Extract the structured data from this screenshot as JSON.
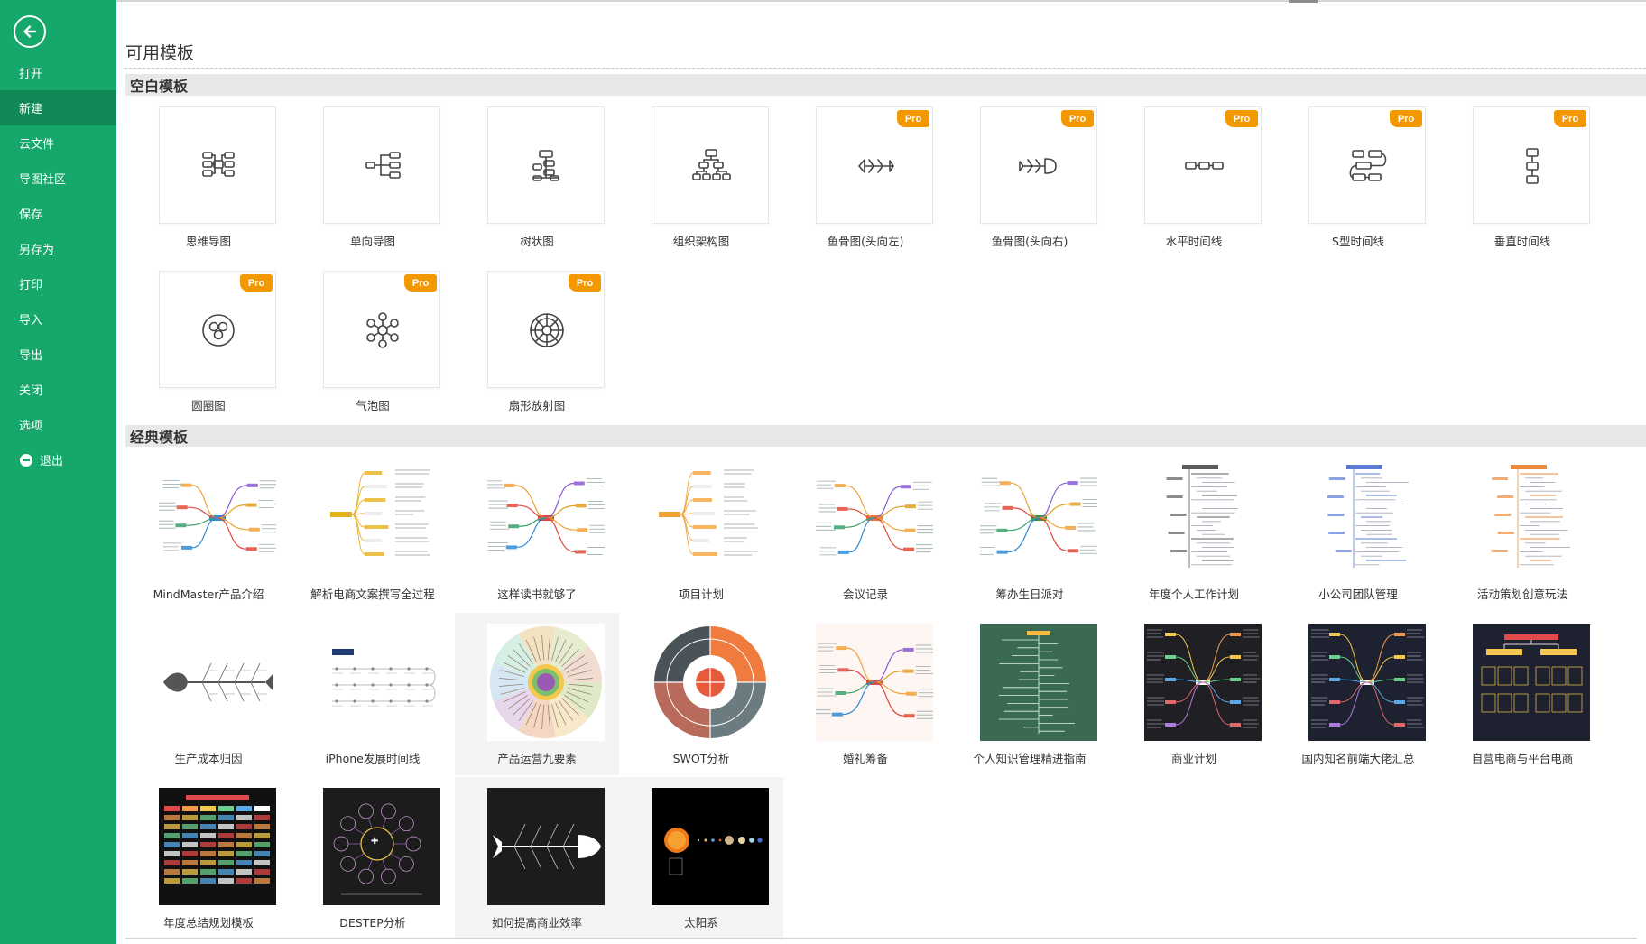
{
  "sidebar": {
    "back_icon": "arrow-left-icon",
    "items": [
      {
        "label": "打开"
      },
      {
        "label": "新建",
        "active": true
      },
      {
        "label": "云文件"
      },
      {
        "label": "导图社区"
      },
      {
        "label": "保存"
      },
      {
        "label": "另存为"
      },
      {
        "label": "打印"
      },
      {
        "label": "导入"
      },
      {
        "label": "导出"
      },
      {
        "label": "关闭"
      },
      {
        "label": "选项"
      },
      {
        "label": "退出",
        "icon": "minus-circle-icon"
      }
    ]
  },
  "page": {
    "title": "可用模板"
  },
  "blank_section": {
    "title": "空白模板",
    "pro_label": "Pro",
    "templates": [
      {
        "label": "思维导图",
        "icon": "mind-map-icon",
        "pro": false
      },
      {
        "label": "单向导图",
        "icon": "right-map-icon",
        "pro": false
      },
      {
        "label": "树状图",
        "icon": "tree-map-icon",
        "pro": false
      },
      {
        "label": "组织架构图",
        "icon": "org-chart-icon",
        "pro": false
      },
      {
        "label": "鱼骨图(头向左)",
        "icon": "fishbone-left-icon",
        "pro": true
      },
      {
        "label": "鱼骨图(头向右)",
        "icon": "fishbone-right-icon",
        "pro": true
      },
      {
        "label": "水平时间线",
        "icon": "horizontal-timeline-icon",
        "pro": true
      },
      {
        "label": "S型时间线",
        "icon": "s-timeline-icon",
        "pro": true
      },
      {
        "label": "垂直时间线",
        "icon": "vertical-timeline-icon",
        "pro": true
      },
      {
        "label": "圆圈图",
        "icon": "circle-map-icon",
        "pro": true
      },
      {
        "label": "气泡图",
        "icon": "bubble-map-icon",
        "pro": true
      },
      {
        "label": "扇形放射图",
        "icon": "sector-radial-icon",
        "pro": true
      }
    ]
  },
  "classic_section": {
    "title": "经典模板",
    "templates": [
      {
        "label": "MindMaster产品介绍",
        "style": "light-mind",
        "theme": "#2e8bd6"
      },
      {
        "label": "解析电商文案撰写全过程",
        "style": "light-tree",
        "theme": "#e6b020"
      },
      {
        "label": "这样读书就够了",
        "style": "light-mind",
        "theme": "#e04a3c"
      },
      {
        "label": "项目计划",
        "style": "light-tree",
        "theme": "#f2a23a"
      },
      {
        "label": "会议记录",
        "style": "light-mind",
        "theme": "#e8743b"
      },
      {
        "label": "筹办生日派对",
        "style": "light-mind",
        "theme": "#3a8f4a"
      },
      {
        "label": "年度个人工作计划",
        "style": "light-vertical",
        "theme": "#5a5a5a"
      },
      {
        "label": "小公司团队管理",
        "style": "light-vertical",
        "theme": "#5b7bd5"
      },
      {
        "label": "活动策划创意玩法",
        "style": "light-vertical",
        "theme": "#e8893b"
      },
      {
        "label": "生产成本归因",
        "style": "fishbone-light",
        "theme": "#555555"
      },
      {
        "label": "iPhone发展时间线",
        "style": "timeline-light",
        "theme": "#1e3c72"
      },
      {
        "label": "产品运营九要素",
        "style": "radial-pastel",
        "theme": "#7bbf6a"
      },
      {
        "label": "SWOT分析",
        "style": "swot",
        "theme": "#e85a3c"
      },
      {
        "label": "婚礼筹备",
        "style": "light-pink",
        "theme": "#e04a4a"
      },
      {
        "label": "个人知识管理精进指南",
        "style": "dark-green",
        "theme": "#3a6b52"
      },
      {
        "label": "商业计划",
        "style": "dark-mind",
        "theme": "#1f1f24"
      },
      {
        "label": "国内知名前端大佬汇总",
        "style": "dark-blue",
        "theme": "#1e2230"
      },
      {
        "label": "自营电商与平台电商",
        "style": "dark-org",
        "theme": "#1e2230"
      },
      {
        "label": "年度总结规划模板",
        "style": "dark-table",
        "theme": "#111111"
      },
      {
        "label": "DESTEP分析",
        "style": "dark-bubble",
        "theme": "#1c1c1c"
      },
      {
        "label": "如何提高商业效率",
        "style": "dark-fishbone",
        "theme": "#1c1c1c"
      },
      {
        "label": "太阳系",
        "style": "solar",
        "theme": "#000000"
      }
    ]
  }
}
